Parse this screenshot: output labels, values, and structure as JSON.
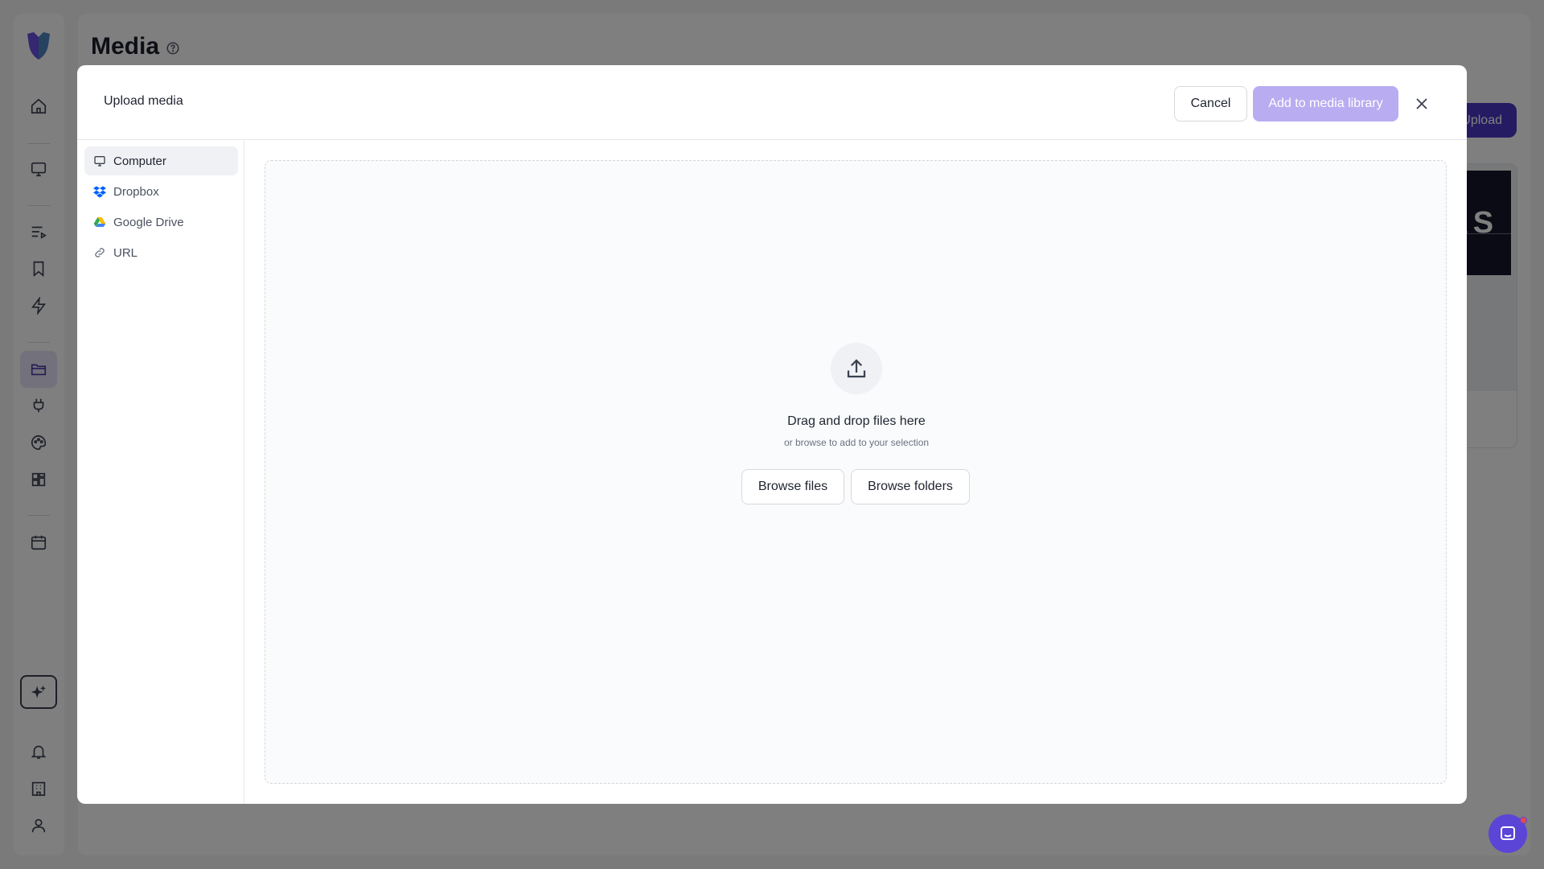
{
  "page": {
    "title": "Media",
    "upload_label": "Upload",
    "thumbnail_text": "ERS"
  },
  "sidebar": {
    "icons": [
      "home-icon",
      "monitor-icon",
      "playlist-icon",
      "bookmark-icon",
      "lightning-icon",
      "folder-icon",
      "plug-icon",
      "palette-icon",
      "grid-icon",
      "calendar-icon",
      "sparkles-icon",
      "bell-icon",
      "building-icon",
      "user-icon"
    ],
    "active": "folder-icon"
  },
  "modal": {
    "title": "Upload media",
    "cancel_label": "Cancel",
    "add_label": "Add to media library",
    "sources": [
      {
        "label": "Computer",
        "icon": "monitor-icon"
      },
      {
        "label": "Dropbox",
        "icon": "dropbox-icon"
      },
      {
        "label": "Google Drive",
        "icon": "google-drive-icon"
      },
      {
        "label": "URL",
        "icon": "link-icon"
      }
    ],
    "active_source": "Computer",
    "dropzone": {
      "title": "Drag and drop files here",
      "subtitle": "or browse to add to your selection",
      "browse_files": "Browse files",
      "browse_folders": "Browse folders"
    }
  },
  "colors": {
    "accent": "#4a36c4",
    "add_button_disabled": "#b9acf1",
    "overlay": "rgba(0,0,0,0.5)"
  }
}
